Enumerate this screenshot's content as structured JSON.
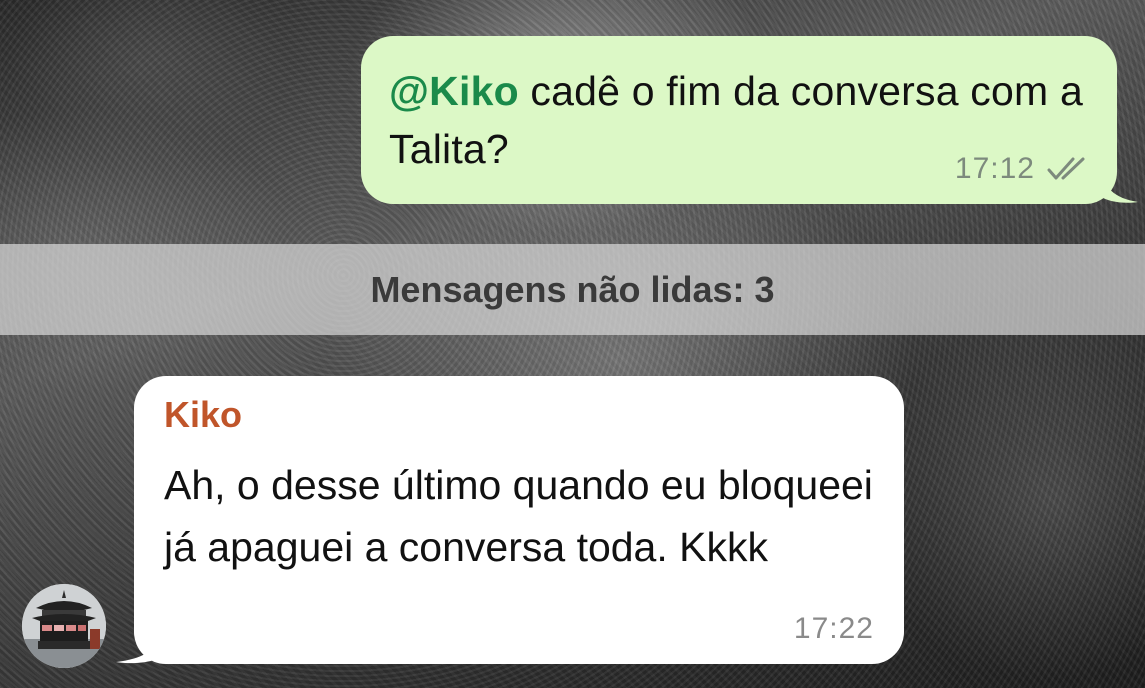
{
  "outgoing_message": {
    "mention": "@Kiko",
    "text": " cadê o fim da conversa com a Talita?",
    "time": "17:12",
    "status_icon": "double-check-icon"
  },
  "unread_banner": {
    "label": "Mensagens não lidas: 3"
  },
  "incoming_message": {
    "sender": "Kiko",
    "text": "Ah, o desse último quando eu bloqueei já apaguei a conversa toda. Kkkk",
    "time": "17:22"
  },
  "avatar": {
    "icon": "pagoda-avatar-icon"
  },
  "colors": {
    "outgoing_bubble": "#dcf8c6",
    "incoming_bubble": "#ffffff",
    "mention": "#1a8a4a",
    "sender_name": "#c0552a",
    "banner": "#d7d7d7"
  }
}
